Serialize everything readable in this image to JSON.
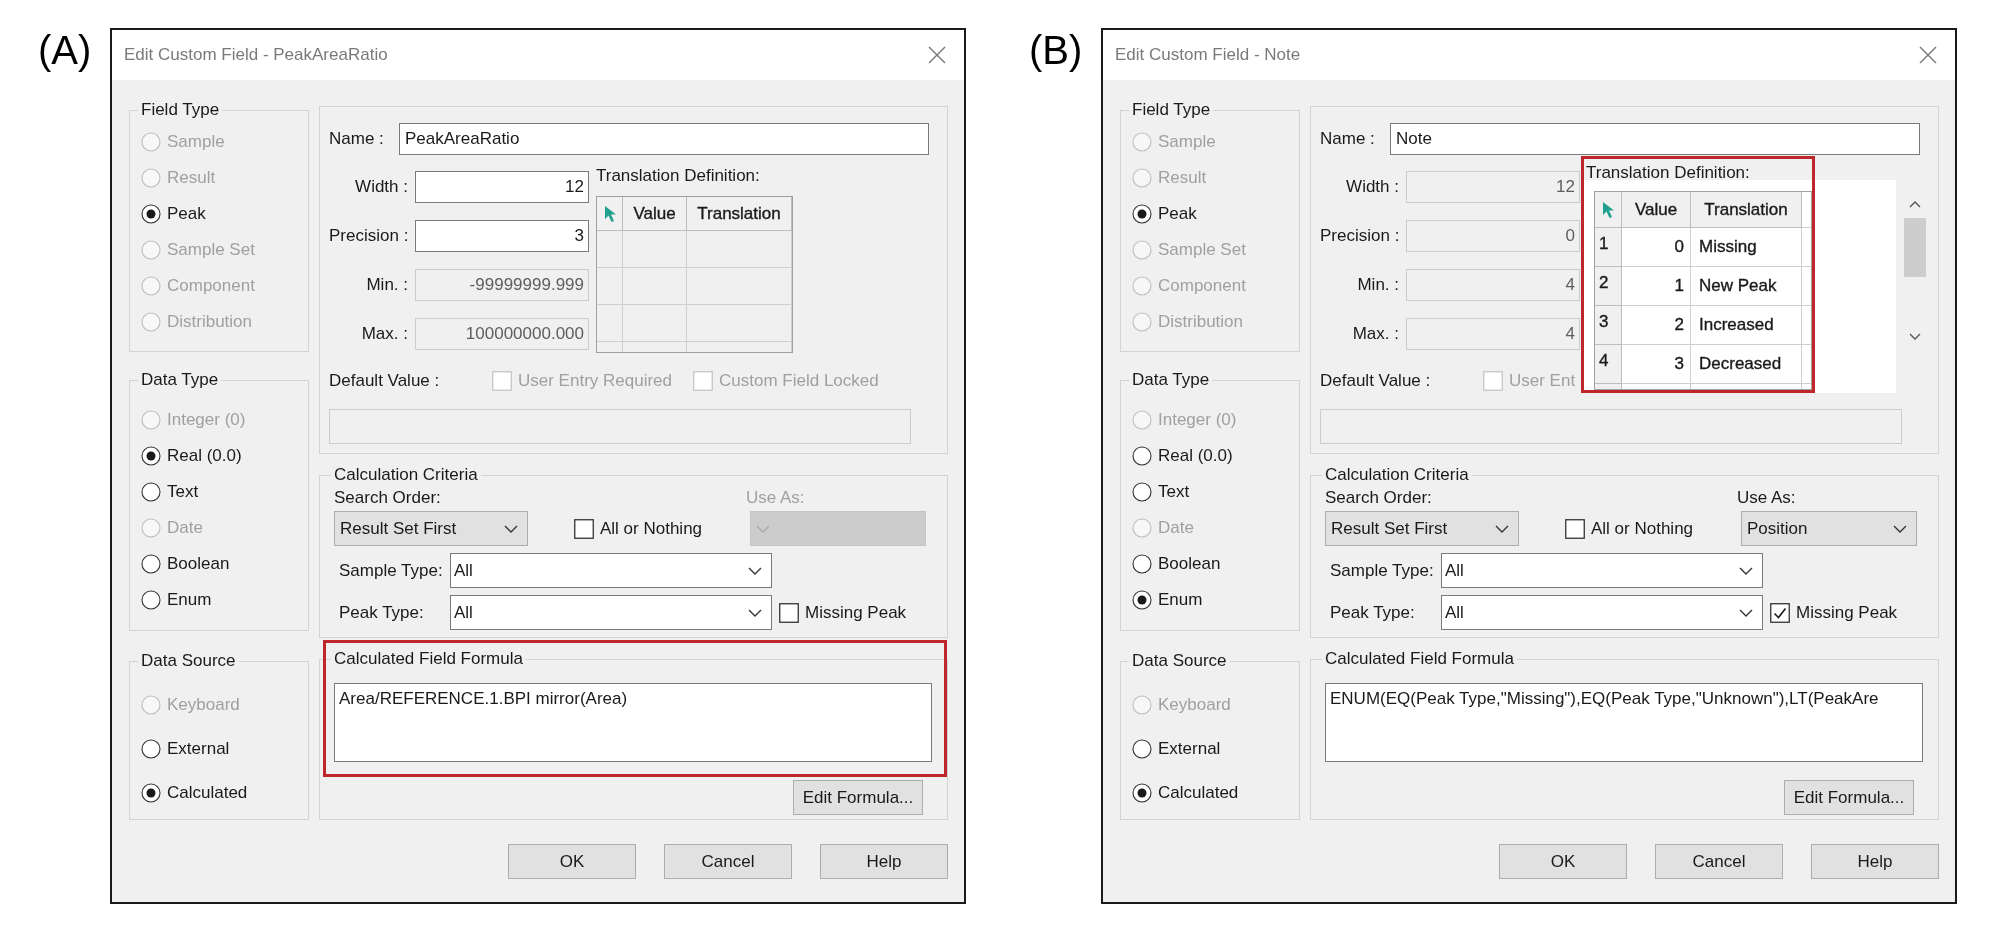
{
  "panels": [
    {
      "label": "(A)",
      "window": {
        "title": "Edit Custom Field - PeakAreaRatio"
      },
      "field_type": {
        "title": "Field Type",
        "options": [
          {
            "label": "Sample",
            "selected": false,
            "disabled": true
          },
          {
            "label": "Result",
            "selected": false,
            "disabled": true
          },
          {
            "label": "Peak",
            "selected": true,
            "disabled": false
          },
          {
            "label": "Sample Set",
            "selected": false,
            "disabled": true
          },
          {
            "label": "Component",
            "selected": false,
            "disabled": true
          },
          {
            "label": "Distribution",
            "selected": false,
            "disabled": true
          }
        ]
      },
      "data_type": {
        "title": "Data Type",
        "options": [
          {
            "label": "Integer (0)",
            "selected": false,
            "disabled": true
          },
          {
            "label": "Real (0.0)",
            "selected": true,
            "disabled": false
          },
          {
            "label": "Text",
            "selected": false,
            "disabled": false
          },
          {
            "label": "Date",
            "selected": false,
            "disabled": true
          },
          {
            "label": "Boolean",
            "selected": false,
            "disabled": false
          },
          {
            "label": "Enum",
            "selected": false,
            "disabled": false
          }
        ]
      },
      "data_source": {
        "title": "Data Source",
        "options": [
          {
            "label": "Keyboard",
            "selected": false,
            "disabled": true
          },
          {
            "label": "External",
            "selected": false,
            "disabled": false
          },
          {
            "label": "Calculated",
            "selected": true,
            "disabled": false
          }
        ]
      },
      "name": {
        "label": "Name :",
        "value": "PeakAreaRatio"
      },
      "numeric_fields": [
        {
          "label": "Width :",
          "value": "12",
          "disabled": false
        },
        {
          "label": "Precision :",
          "value": "3",
          "disabled": false
        },
        {
          "label": "Min. :",
          "value": "-99999999.999",
          "disabled": true
        },
        {
          "label": "Max. :",
          "value": "100000000.000",
          "disabled": true
        }
      ],
      "translation": {
        "title": "Translation Definition:",
        "disabled": true,
        "highlighted": false,
        "columns": [
          "Value",
          "Translation"
        ]
      },
      "default_value": {
        "label": "Default Value :",
        "disabled": true
      },
      "options": [
        {
          "label": "User Entry Required",
          "checked": false,
          "disabled": true
        },
        {
          "label": "Custom Field Locked",
          "checked": false,
          "disabled": true
        }
      ],
      "calculation_criteria": {
        "title": "Calculation Criteria",
        "search_order": {
          "label": "Search Order:",
          "value": "Result Set First"
        },
        "all_or_nothing": {
          "label": "All or Nothing",
          "checked": false
        },
        "use_as": {
          "label": "Use As:",
          "disabled": true
        },
        "sample_type": {
          "label": "Sample Type:",
          "value": "All"
        },
        "peak_type": {
          "label": "Peak Type:",
          "value": "All"
        },
        "missing_peak": {
          "label": "Missing Peak",
          "checked": false
        }
      },
      "formula": {
        "title": "Calculated Field Formula",
        "value": "Area/REFERENCE.1.BPI mirror(Area)",
        "highlighted": true,
        "edit_button": "Edit Formula..."
      },
      "buttons": [
        "OK",
        "Cancel",
        "Help"
      ]
    },
    {
      "label": "(B)",
      "window": {
        "title": "Edit Custom Field - Note"
      },
      "field_type": {
        "title": "Field Type",
        "options": [
          {
            "label": "Sample",
            "selected": false,
            "disabled": true
          },
          {
            "label": "Result",
            "selected": false,
            "disabled": true
          },
          {
            "label": "Peak",
            "selected": true,
            "disabled": false
          },
          {
            "label": "Sample Set",
            "selected": false,
            "disabled": true
          },
          {
            "label": "Component",
            "selected": false,
            "disabled": true
          },
          {
            "label": "Distribution",
            "selected": false,
            "disabled": true
          }
        ]
      },
      "data_type": {
        "title": "Data Type",
        "options": [
          {
            "label": "Integer (0)",
            "selected": false,
            "disabled": true
          },
          {
            "label": "Real (0.0)",
            "selected": false,
            "disabled": false
          },
          {
            "label": "Text",
            "selected": false,
            "disabled": false
          },
          {
            "label": "Date",
            "selected": false,
            "disabled": true
          },
          {
            "label": "Boolean",
            "selected": false,
            "disabled": false
          },
          {
            "label": "Enum",
            "selected": true,
            "disabled": false
          }
        ]
      },
      "data_source": {
        "title": "Data Source",
        "options": [
          {
            "label": "Keyboard",
            "selected": false,
            "disabled": true
          },
          {
            "label": "External",
            "selected": false,
            "disabled": false
          },
          {
            "label": "Calculated",
            "selected": true,
            "disabled": false
          }
        ]
      },
      "name": {
        "label": "Name :",
        "value": "Note"
      },
      "numeric_fields": [
        {
          "label": "Width :",
          "value": "12",
          "disabled": true
        },
        {
          "label": "Precision :",
          "value": "0",
          "disabled": true
        },
        {
          "label": "Min. :",
          "value": "4",
          "disabled": true
        },
        {
          "label": "Max. :",
          "value": "4",
          "disabled": true
        }
      ],
      "translation": {
        "title": "Translation Definition:",
        "disabled": false,
        "highlighted": true,
        "columns": [
          "Value",
          "Translation"
        ],
        "rows": [
          {
            "number": "1",
            "value": "0",
            "translation": "Missing"
          },
          {
            "number": "2",
            "value": "1",
            "translation": "New Peak"
          },
          {
            "number": "3",
            "value": "2",
            "translation": "Increased"
          },
          {
            "number": "4",
            "value": "3",
            "translation": "Decreased"
          }
        ]
      },
      "default_value": {
        "label": "Default Value :",
        "disabled": true
      },
      "options": [
        {
          "label": "User Ent",
          "checked": false,
          "disabled": true
        }
      ],
      "calculation_criteria": {
        "title": "Calculation Criteria",
        "search_order": {
          "label": "Search Order:",
          "value": "Result Set First"
        },
        "all_or_nothing": {
          "label": "All or Nothing",
          "checked": false
        },
        "use_as": {
          "label": "Use As:",
          "value": "Position",
          "disabled": false
        },
        "sample_type": {
          "label": "Sample Type:",
          "value": "All"
        },
        "peak_type": {
          "label": "Peak Type:",
          "value": "All"
        },
        "missing_peak": {
          "label": "Missing Peak",
          "checked": true
        }
      },
      "formula": {
        "title": "Calculated Field Formula",
        "value": "ENUM(EQ(Peak Type,\"Missing\"),EQ(Peak Type,\"Unknown\"),LT(PeakAre",
        "highlighted": false,
        "edit_button": "Edit Formula..."
      },
      "buttons": [
        "OK",
        "Cancel",
        "Help"
      ]
    }
  ]
}
